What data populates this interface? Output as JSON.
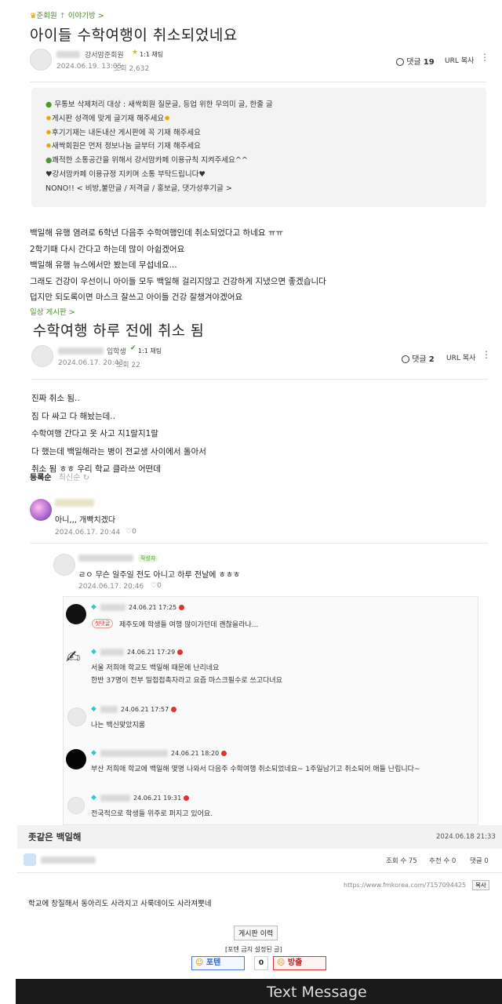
{
  "post1": {
    "breadcrumb_group": "준회원",
    "breadcrumb_board": "이야기방 >",
    "title": "아이들 수학여행이 취소되었네요",
    "author_grade": "강서맘준회원",
    "chat_label": "1:1 채팅",
    "date": "2024.06.19. 13:05",
    "views": "조회 2,632",
    "comments_label": "댓글",
    "comments_count": "19",
    "url_copy": "URL 복사",
    "notice": [
      "무통보 삭제처리 대상 : 새싹회원 질문글, 등업 위한 무의미 글, 한줄 글",
      "게시판 성격에 맞게 글기재 해주세요",
      "후기기재는 내돈내산 게시판에 꼭 기재 해주세요",
      "새싹회원은 먼저 정보나눔 글부터 기재 해주세요",
      "쾌적한 소통공간을 위해서 강서맘카페 이용규칙 지켜주세요^^",
      "♥강서맘카페 이용규정 지키며 소통 부탁드립니다♥",
      "NONO!! < 비방,불만글 / 저격글 / 홍보글, 댓가성후기글 >"
    ],
    "body": [
      "백일해 유행 염려로 6학년 다음주 수학여행인데 취소되었다고 하네요 ㅠㅠ",
      "2학기때 다시 간다고 하는데 많이 아쉽겠어요",
      "백일해 유행 뉴스에서만 봤는데 무섭네요...",
      "그래도 건강이 우선이니 아이들 모두 백일해 걸리지않고 건강하게 지냈으면 좋겠습니다",
      "덥지만 되도록이면 마스크 잘쓰고 아이들 건강 잘챙겨야겠어요"
    ]
  },
  "post2": {
    "board": "일상 게시판 >",
    "title": "수학여행 하루 전에 취소 됨",
    "author_grade": "입학생",
    "chat_label": "1:1 채팅",
    "date": "2024.06.17. 20:43",
    "views": "조회 22",
    "comments_label": "댓글",
    "comments_count": "2",
    "url_copy": "URL 복사",
    "body": [
      "진짜 취소 됨..",
      "짐 다 싸고 다 해놨는데..",
      "수학여행 간다고 옷 사고 지1랄지1랄",
      "다 했는데 백일해라는 병이 전교생 사이에서 돌아서",
      "취소 됨 ㅎㅎ 우리 학교 클라쓰 어떤데"
    ],
    "sort_registered": "등록순",
    "sort_latest": "최신순",
    "comment1_text": "아니,,, 개빡치겠다",
    "comment1_date": "2024.06.17. 20:44",
    "comment1_likes": "0",
    "comment2_writer_badge": "작성자",
    "comment2_text": "ㄹㅇ 무슨 일주일 전도 아니고 하루 전날에 ㅎㅎㅎ",
    "comment2_date": "2024.06.17. 20:46",
    "comment2_likes": "0"
  },
  "replies": [
    {
      "date": "24.06.21 17:25",
      "tag": "첫댓글",
      "text": "제주도에 학생들 여행 많이가던데 괜찮을라나..."
    },
    {
      "date": "24.06.21 17:29",
      "tag": "",
      "text": "서울 저희애 학교도 백일해 때문에 난리네요",
      "text2": "한반 37명이 전부 밀접접촉자라고 요즘 마스크필수로 쓰고다녀요"
    },
    {
      "date": "24.06.21 17:57",
      "tag": "",
      "text": "나는 백신맞았지롱"
    },
    {
      "date": "24.06.21 18:20",
      "tag": "",
      "text": "부산 저희애 학교에 백일해 몇명 나와서 다음주 수학여행 취소되었네요~ 1주일남기고 취소되어 애들 난립니다~"
    },
    {
      "date": "24.06.21 19:31",
      "tag": "",
      "text": "전국적으로 학생들 위주로 퍼지고 있어요."
    }
  ],
  "fm": {
    "title": "좃같은 백일해",
    "date": "2024.06.18 21:33",
    "views": "조회 수 75",
    "recommend": "추천 수 0",
    "comments": "댓글 0",
    "url": "https://www.fmkorea.com/7157094425",
    "copy": "복사",
    "body": "학교에 창질해서 동아리도 사라지고 사룩데이도 사라져뿟네",
    "history_btn": "게시판 이력",
    "potent_notice": "[포텐 금지 설정된 글]",
    "potent_btn": "포텐",
    "potent_count": "0",
    "bangchul_btn": "방출"
  },
  "bottom_bar": {
    "label": "Text Message"
  },
  "colors": {
    "accent_green": "#5a9a2a",
    "star": "#e8b400",
    "red": "#d33333",
    "bar": "#1a1a1a"
  }
}
